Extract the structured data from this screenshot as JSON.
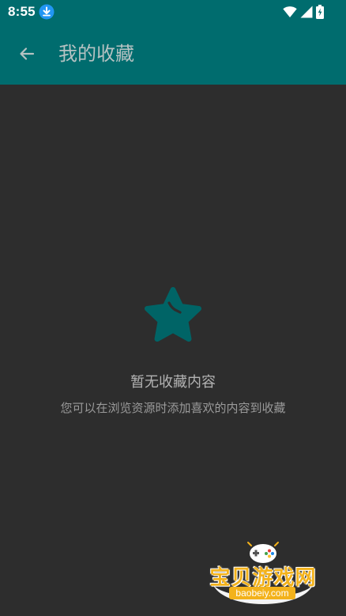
{
  "status_bar": {
    "time": "8:55",
    "icons": [
      "download-icon",
      "wifi-icon",
      "signal-icon",
      "battery-charging-icon"
    ]
  },
  "app_bar": {
    "back_icon": "arrow-left-icon",
    "title": "我的收藏"
  },
  "empty_state": {
    "icon": "star-icon",
    "title": "暂无收藏内容",
    "subtitle": "您可以在浏览资源时添加喜欢的内容到收藏"
  },
  "watermark": {
    "name": "宝贝游戏网",
    "url": "baobeiy.com"
  },
  "colors": {
    "primary": "#006c6e",
    "background": "#2d2d2d",
    "title_text": "#b6c2c2",
    "empty_icon": "#006466",
    "empty_title": "#b3b3b3",
    "empty_subtitle": "#9a9a9a",
    "download_badge": "#2196f3",
    "watermark_gold": "#f3b21b"
  }
}
